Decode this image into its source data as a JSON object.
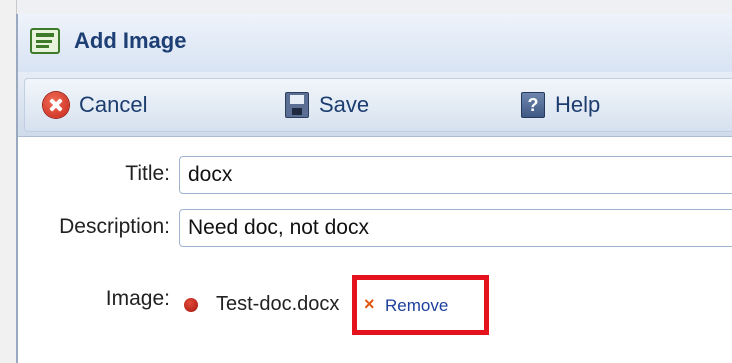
{
  "dialog": {
    "title": "Add Image"
  },
  "toolbar": {
    "cancel_label": "Cancel",
    "save_label": "Save",
    "help_label": "Help"
  },
  "help_icon_glyph": "?",
  "form": {
    "title_label": "Title:",
    "title_value": "docx",
    "description_label": "Description:",
    "description_value": "Need doc, not docx",
    "image_label": "Image:",
    "image_file": "Test-doc.docx",
    "remove_mark": "×",
    "remove_label": "Remove"
  },
  "colors": {
    "title_text": "#1d3f74",
    "highlight": "#e4121d",
    "link": "#1d3f9e",
    "remove_x": "#e2570f"
  },
  "icons": [
    "document-icon",
    "cancel-icon",
    "save-icon",
    "help-icon",
    "bullet-icon",
    "remove-icon"
  ]
}
